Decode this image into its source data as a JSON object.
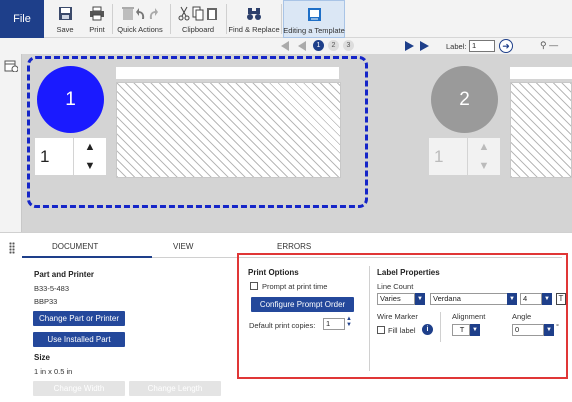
{
  "ribbon": {
    "file_label": "File",
    "save_label": "Save",
    "print_label": "Print",
    "quick_actions_label": "Quick Actions",
    "clipboard_label": "Clipboard",
    "find_replace_label": "Find & Replace",
    "editing_template_label": "Editing a Template"
  },
  "nav": {
    "pages": [
      "1",
      "2",
      "3"
    ],
    "label_caption": "Label:",
    "label_value": "1"
  },
  "canvas": {
    "label1": {
      "number": "1",
      "quantity": "1",
      "color": "#1a1aff"
    },
    "label2": {
      "number": "2",
      "quantity": "1",
      "color": "#9a9a9a"
    }
  },
  "tabs": {
    "document": "DOCUMENT",
    "view": "VIEW",
    "errors": "ERRORS"
  },
  "document": {
    "part_printer_heading": "Part and Printer",
    "part_number": "B33-5-483",
    "printer": "BBP33",
    "change_part_button": "Change Part or Printer",
    "use_installed_button": "Use Installed Part",
    "size_heading": "Size",
    "size_value": "1 in x 0.5 in",
    "change_width_button": "Change Width",
    "change_length_button": "Change Length"
  },
  "print_options": {
    "heading": "Print Options",
    "prompt_checkbox_label": "Prompt at print time",
    "configure_button": "Configure Prompt Order",
    "default_copies_label": "Default print copies:",
    "default_copies_value": "1"
  },
  "label_properties": {
    "heading": "Label Properties",
    "line_count_label": "Line Count",
    "line_count_value": "Varies",
    "font_value": "Verdana",
    "font_size_value": "4",
    "wire_marker_label": "Wire Marker",
    "fill_label": "Fill label",
    "alignment_label": "Alignment",
    "alignment_value": "T",
    "angle_label": "Angle",
    "angle_value": "0",
    "degree_symbol": "°"
  }
}
